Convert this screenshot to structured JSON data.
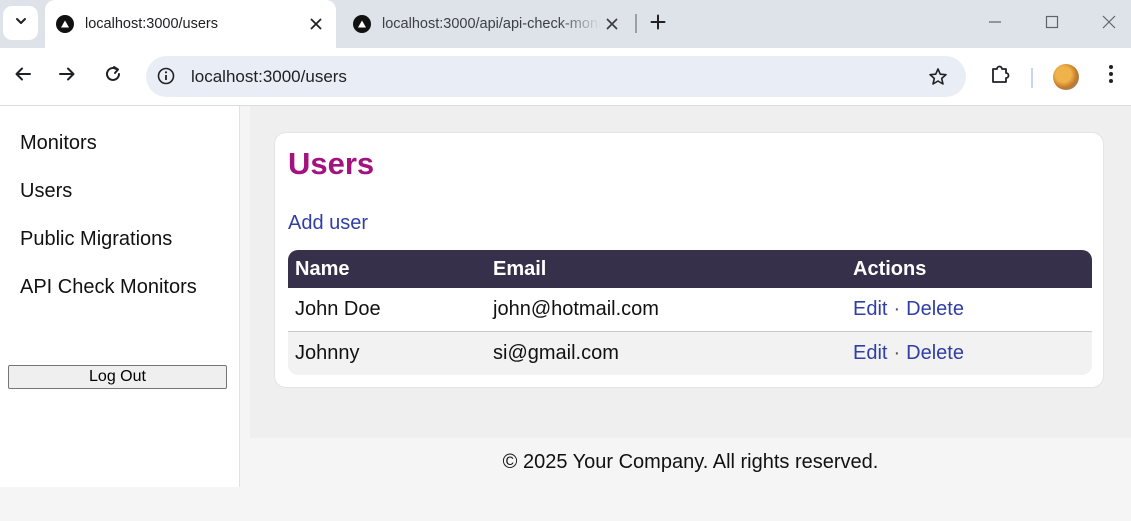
{
  "browser": {
    "tabs": [
      {
        "title": "localhost:3000/users",
        "active": true
      },
      {
        "title": "localhost:3000/api/api-check-monitors",
        "active": false
      }
    ],
    "address": "localhost:3000/users",
    "icons": {
      "tab_search": "chevron-down-icon",
      "favicon": "triangle-logo-icon",
      "close": "close-icon",
      "new_tab": "plus-icon",
      "back": "arrow-left-icon",
      "forward": "arrow-right-icon",
      "reload": "reload-icon",
      "site_info": "info-icon",
      "bookmark": "star-icon",
      "extensions": "puzzle-icon",
      "menu": "kebab-menu-icon"
    }
  },
  "sidebar": {
    "items": [
      {
        "label": "Monitors"
      },
      {
        "label": "Users"
      },
      {
        "label": "Public Migrations"
      },
      {
        "label": "API Check Monitors"
      }
    ],
    "logout_label": "Log Out"
  },
  "page": {
    "title": "Users",
    "add_user_label": "Add user",
    "table": {
      "columns": [
        "Name",
        "Email",
        "Actions"
      ],
      "rows": [
        {
          "name": "John Doe",
          "email": "john@hotmail.com",
          "edit": "Edit",
          "separator": "·",
          "delete": "Delete"
        },
        {
          "name": "Johnny",
          "email": "si@gmail.com",
          "edit": "Edit",
          "separator": "·",
          "delete": "Delete"
        }
      ]
    }
  },
  "footer": {
    "text": "© 2025 Your Company. All rights reserved."
  },
  "colors": {
    "title": "#a3137f",
    "link": "#2f3fa5",
    "table_header_bg": "#37304a",
    "tabbar_bg": "#dee3ea",
    "omnibox_bg": "#e9eef6"
  }
}
